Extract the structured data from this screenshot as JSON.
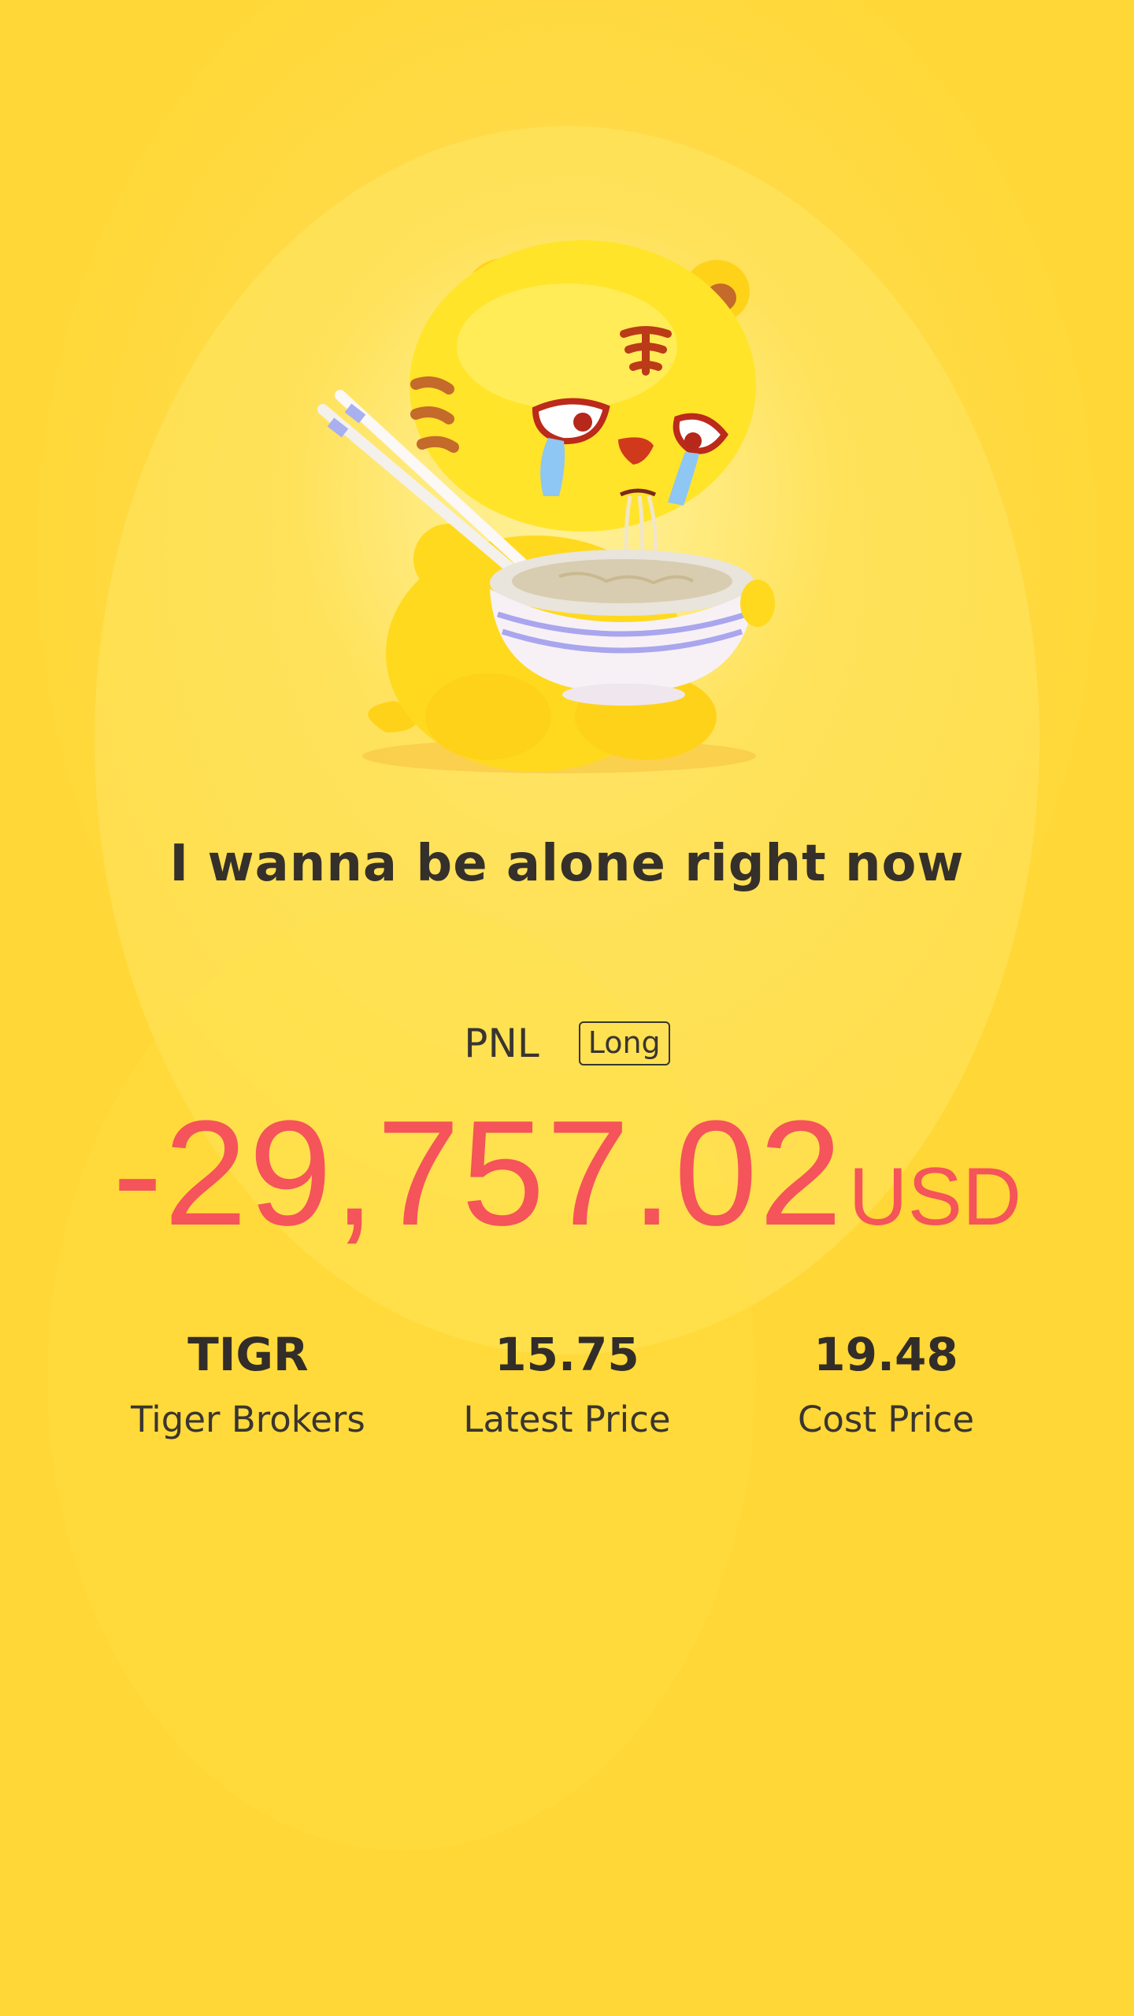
{
  "message": "I wanna be alone right now",
  "pnl": {
    "label": "PNL",
    "position": "Long",
    "amount": "-29,757.02",
    "currency": "USD",
    "color": "#f4545a"
  },
  "stats": [
    {
      "value": "TIGR",
      "label": "Tiger Brokers"
    },
    {
      "value": "15.75",
      "label": "Latest Price"
    },
    {
      "value": "19.48",
      "label": "Cost Price"
    }
  ],
  "mascot": {
    "icon": "crying-tiger-eating-noodles-icon"
  },
  "colors": {
    "background": "#ffd736",
    "text": "#35302a",
    "loss": "#f4545a"
  }
}
